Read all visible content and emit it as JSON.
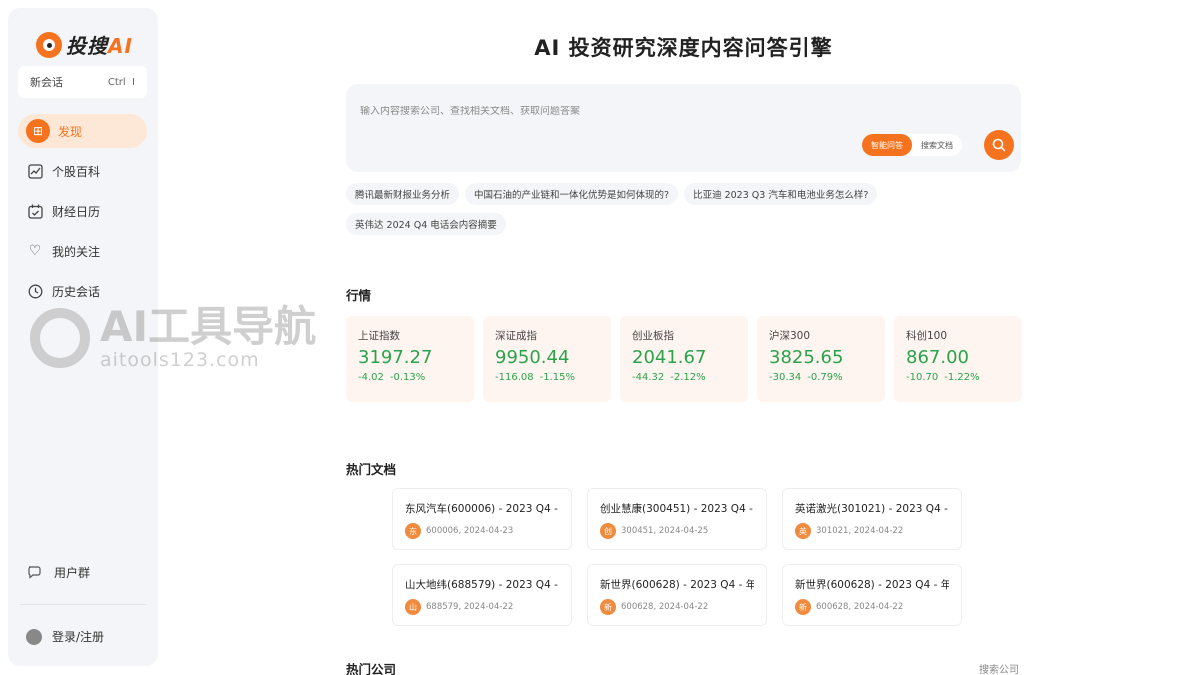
{
  "app": {
    "logo_text": "投搜",
    "logo_ai": "AI"
  },
  "sidebar": {
    "new_chat": "新会话",
    "shortcut": "Ctrl",
    "shortcut_suffix": "I",
    "items": [
      {
        "label": "发现",
        "icon": "discover-icon",
        "glyph": "䷀",
        "active": true
      },
      {
        "label": "个股百科",
        "icon": "chart-icon",
        "glyph": "📈",
        "active": false
      },
      {
        "label": "财经日历",
        "icon": "calendar-icon",
        "glyph": "📅",
        "active": false
      },
      {
        "label": "我的关注",
        "icon": "heart-icon",
        "glyph": "♡",
        "active": false
      },
      {
        "label": "历史会话",
        "icon": "clock-icon",
        "glyph": "◷",
        "active": false
      }
    ],
    "user_group": "用户群",
    "login": "登录/注册"
  },
  "watermark": {
    "title": "AI工具导航",
    "url": "aitools123.com"
  },
  "main": {
    "title": "AI 投资研究深度内容问答引擎",
    "search_placeholder": "输入内容搜索公司、查找相关文档、获取问题答案",
    "mode_smart": "智能问答",
    "mode_docs": "搜索文档",
    "suggestions": [
      "腾讯最新财报业务分析",
      "中国石油的产业链和一体化优势是如何体现的?",
      "比亚迪 2023 Q3 汽车和电池业务怎么样?",
      "英伟达 2024 Q4 电话会内容摘要"
    ],
    "market_title": "行情",
    "market": [
      {
        "name": "上证指数",
        "value": "3197.27",
        "change": "-4.02",
        "pct": "-0.13%"
      },
      {
        "name": "深证成指",
        "value": "9950.44",
        "change": "-116.08",
        "pct": "-1.15%"
      },
      {
        "name": "创业板指",
        "value": "2041.67",
        "change": "-44.32",
        "pct": "-2.12%"
      },
      {
        "name": "沪深300",
        "value": "3825.65",
        "change": "-30.34",
        "pct": "-0.79%"
      },
      {
        "name": "科创100",
        "value": "867.00",
        "change": "-10.70",
        "pct": "-1.22%"
      }
    ],
    "docs_title": "热门文档",
    "docs": [
      {
        "title": "东风汽车(600006) - 2023 Q4 -",
        "badge": "东",
        "meta": "600006, 2024-04-23"
      },
      {
        "title": "创业慧康(300451) - 2023 Q4 -",
        "badge": "创",
        "meta": "300451, 2024-04-25"
      },
      {
        "title": "英诺激光(301021) - 2023 Q4 -",
        "badge": "英",
        "meta": "301021, 2024-04-22"
      },
      {
        "title": "山大地纬(688579) - 2023 Q4 -",
        "badge": "山",
        "meta": "688579, 2024-04-22"
      },
      {
        "title": "新世界(600628) - 2023 Q4 - 年",
        "badge": "新",
        "meta": "600628, 2024-04-22"
      },
      {
        "title": "新世界(600628) - 2023 Q4 - 年",
        "badge": "新",
        "meta": "600628, 2024-04-22"
      }
    ],
    "companies_title": "热门公司",
    "search_company": "搜索公司"
  },
  "colors": {
    "accent": "#f5731f",
    "market_down": "#2ba24c",
    "card_bg": "#fff5f0"
  }
}
